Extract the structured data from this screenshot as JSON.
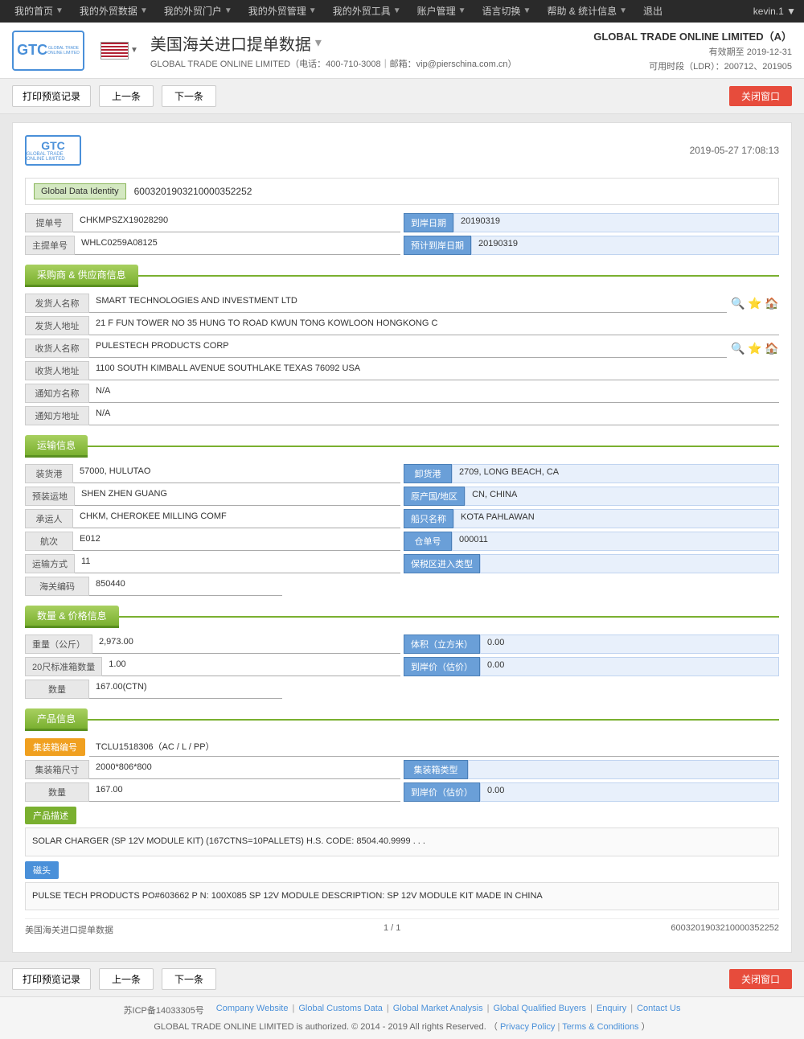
{
  "nav": {
    "items": [
      {
        "label": "我的首页",
        "arrow": true
      },
      {
        "label": "我的外贸数据",
        "arrow": true
      },
      {
        "label": "我的外贸门户",
        "arrow": true
      },
      {
        "label": "我的外贸管理",
        "arrow": true
      },
      {
        "label": "我的外贸工具",
        "arrow": true
      },
      {
        "label": "账户管理",
        "arrow": true
      },
      {
        "label": "语言切换",
        "arrow": true
      },
      {
        "label": "帮助 & 统计信息",
        "arrow": true
      },
      {
        "label": "退出",
        "arrow": false
      }
    ],
    "user": "kevin.1 ▼"
  },
  "header": {
    "logo_text": "GTC",
    "logo_sub": "GLOBAL TRADE ONLINE LIMITED",
    "title": "美国海关进口提单数据",
    "subtitle": "GLOBAL TRADE ONLINE LIMITED（电话：400-710-3008｜邮箱：vip@pierschina.com.cn）",
    "company": "GLOBAL TRADE ONLINE LIMITED（A）",
    "validity": "有效期至 2019-12-31",
    "ldr": "可用时段（LDR）：200712、201905"
  },
  "toolbar": {
    "print_label": "打印预览记录",
    "prev_label": "上一条",
    "next_label": "下一条",
    "close_label": "关闭窗口"
  },
  "document": {
    "datetime": "2019-05-27 17:08:13",
    "global_data_label": "Global Data Identity",
    "global_data_value": "6003201903210000352252",
    "bill_number_label": "提单号",
    "bill_number_value": "CHKMPSZX19028290",
    "arrival_date_label": "到岸日期",
    "arrival_date_value": "20190319",
    "master_bill_label": "主提单号",
    "master_bill_value": "WHLC0259A08125",
    "est_arrival_label": "预计到岸日期",
    "est_arrival_value": "20190319"
  },
  "supplier_section": {
    "title": "采购商 & 供应商信息",
    "shipper_name_label": "发货人名称",
    "shipper_name_value": "SMART TECHNOLOGIES AND INVESTMENT LTD",
    "shipper_addr_label": "发货人地址",
    "shipper_addr_value": "21 F FUN TOWER NO 35 HUNG TO ROAD KWUN TONG KOWLOON HONGKONG C",
    "consignee_name_label": "收货人名称",
    "consignee_name_value": "PULESTECH PRODUCTS CORP",
    "consignee_addr_label": "收货人地址",
    "consignee_addr_value": "1100 SOUTH KIMBALL AVENUE SOUTHLAKE TEXAS 76092 USA",
    "notify_name_label": "通知方名称",
    "notify_name_value": "N/A",
    "notify_addr_label": "通知方地址",
    "notify_addr_value": "N/A"
  },
  "transport_section": {
    "title": "运输信息",
    "loading_port_label": "装货港",
    "loading_port_value": "57000, HULUTAO",
    "unloading_port_label": "卸货港",
    "unloading_port_value": "2709, LONG BEACH, CA",
    "pre_transport_label": "预装运地",
    "pre_transport_value": "SHEN ZHEN GUANG",
    "origin_label": "原产国/地区",
    "origin_value": "CN, CHINA",
    "carrier_label": "承运人",
    "carrier_value": "CHKM, CHEROKEE MILLING COMF",
    "vessel_label": "船只名称",
    "vessel_value": "KOTA PAHLAWAN",
    "voyage_label": "航次",
    "voyage_value": "E012",
    "container_num_label": "仓单号",
    "container_num_value": "000011",
    "transport_mode_label": "运输方式",
    "transport_mode_value": "11",
    "bonded_zone_label": "保税区进入类型",
    "bonded_zone_value": "",
    "customs_code_label": "海关编码",
    "customs_code_value": "850440"
  },
  "quantity_section": {
    "title": "数量 & 价格信息",
    "weight_label": "重量（公斤）",
    "weight_value": "2,973.00",
    "volume_label": "体积（立方米）",
    "volume_value": "0.00",
    "container_20_label": "20尺标准箱数量",
    "container_20_value": "1.00",
    "landing_price_label": "到岸价（估价）",
    "landing_price_value": "0.00",
    "quantity_label": "数量",
    "quantity_value": "167.00(CTN)"
  },
  "product_section": {
    "title": "产品信息",
    "container_id_label": "集装箱编号",
    "container_id_value": "TCLU1518306（AC / L / PP）",
    "container_size_label": "集装箱尺寸",
    "container_size_value": "2000*806*800",
    "container_type_label": "集装箱类型",
    "container_type_value": "",
    "quantity_label": "数量",
    "quantity_value": "167.00",
    "landing_price_label": "到岸价（估价）",
    "landing_price_value": "0.00",
    "product_desc_label": "产品描述",
    "product_desc_value": "SOLAR CHARGER (SP 12V MODULE KIT) (167CTNS=10PALLETS) H.S. CODE: 8504.40.9999 . . .",
    "head_label": "磁头",
    "head_value": "PULSE TECH PRODUCTS PO#603662 P N: 100X085 SP 12V MODULE DESCRIPTION: SP 12V MODULE KIT MADE IN CHINA"
  },
  "doc_footer": {
    "source_label": "美国海关进口提单数据",
    "page": "1 / 1",
    "doc_id": "6003201903210000352252"
  },
  "footer": {
    "links": [
      "Company Website",
      "Global Customs Data",
      "Global Market Analysis",
      "Global Qualified Buyers",
      "Enquiry",
      "Contact Us"
    ],
    "copyright": "GLOBAL TRADE ONLINE LIMITED is authorized. © 2014 - 2019 All rights Reserved.",
    "privacy": "Privacy Policy",
    "terms": "Terms & Conditions",
    "icp": "苏ICP备14033305号"
  }
}
